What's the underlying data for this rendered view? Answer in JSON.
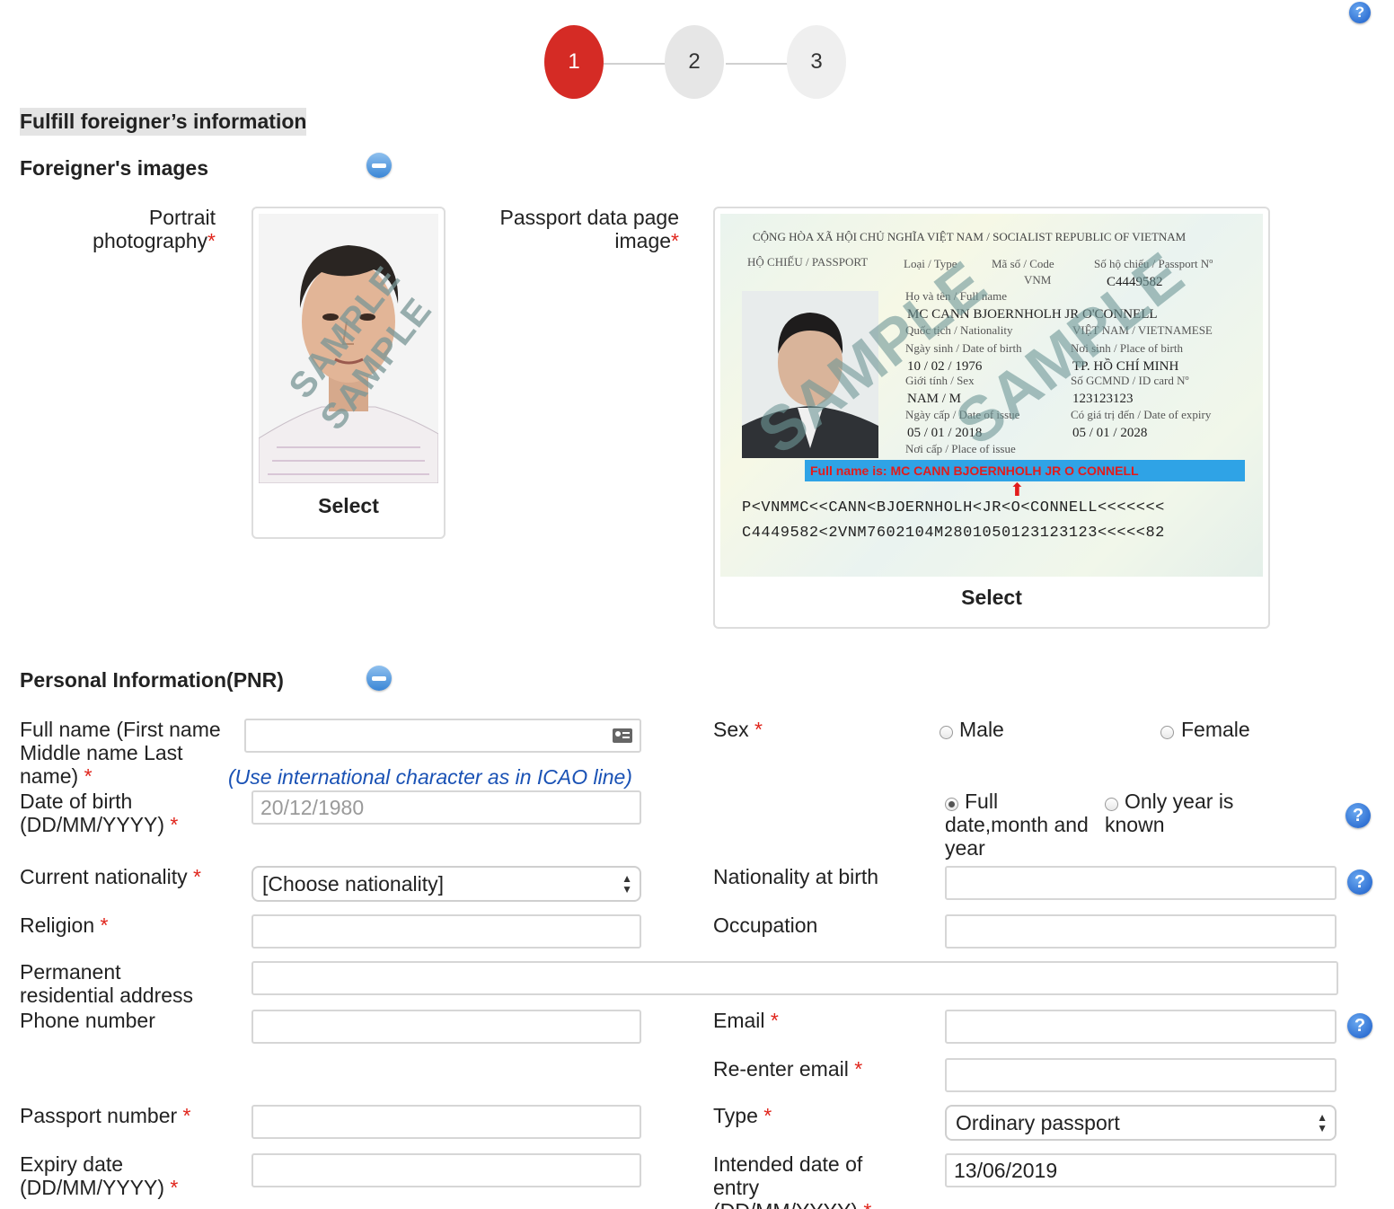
{
  "steps": [
    "1",
    "2",
    "3"
  ],
  "header": {
    "help_icon": "help-icon",
    "title": "Fulfill foreigner’s information"
  },
  "images_section": {
    "title": "Foreigner's images",
    "portrait_label": "Portrait photography",
    "passport_label": "Passport data page image",
    "select_label": "Select",
    "watermark": "SAMPLE"
  },
  "passport_sample": {
    "header": "CỘNG HÒA XÃ HỘI CHỦ NGHĨA VIỆT NAM / SOCIALIST REPUBLIC OF VIETNAM",
    "doc": "HỘ CHIẾU / PASSPORT",
    "type_label": "Loại / Type",
    "code_label": "Mã số / Code",
    "code_value": "VNM",
    "no_label": "Số hộ chiếu / Passport Nº",
    "no_value": "C4449582",
    "name_label": "Họ và tên / Full name",
    "name_value": "MC CANN BJOERNHOLH JR O'CONNELL",
    "nationality_label": "Quốc tịch / Nationality",
    "nationality_value": "VIỆT NAM / VIETNAMESE",
    "dob_label": "Ngày sinh / Date of birth",
    "dob_value": "10 / 02 / 1976",
    "pob_label": "Nơi sinh / Place of birth",
    "pob_value": "TP. HỒ CHÍ MINH",
    "sex_label": "Giới tính / Sex",
    "sex_value": "NAM / M",
    "id_label": "Số GCMND / ID card Nº",
    "id_value": "123123123",
    "issue_label": "Ngày cấp / Date of issue",
    "issue_value": "05 / 01 / 2018",
    "expiry_label": "Có giá trị đến / Date of expiry",
    "expiry_value": "05 / 01 / 2028",
    "poi_label": "Nơi cấp / Place of issue",
    "fullname_banner": "Full name is: MC CANN BJOERNHOLH JR O CONNELL",
    "mrz1": "P<VNMMC<<CANN<BJOERNHOLH<JR<O<CONNELL<<<<<<<",
    "mrz2": "C4449582<2VNM7602104M2801050123123123<<<<<82"
  },
  "personal_section": {
    "title": "Personal Information(PNR)",
    "fullname_label": "Full name (First name Middle name Last name)",
    "fullname_hint": "(Use international character as in ICAO line)",
    "sex_label": "Sex",
    "sex_male": "Male",
    "sex_female": "Female",
    "dob_label": "Date of birth (DD/MM/YYYY)",
    "dob_placeholder": "20/12/1980",
    "dob_full": "Full date,month and year",
    "dob_year": "Only year is known",
    "nationality_label": "Current nationality",
    "nationality_value": "[Choose nationality]",
    "nationality_birth_label": "Nationality at birth",
    "religion_label": "Religion",
    "occupation_label": "Occupation",
    "address_label": "Permanent residential address",
    "phone_label": "Phone number",
    "email_label": "Email",
    "reemail_label": "Re-enter email",
    "passport_no_label": "Passport number",
    "type_label": "Type",
    "type_value": "Ordinary passport",
    "expiry_label": "Expiry date (DD/MM/YYYY)",
    "entry_label": "Intended date of entry (DD/MM/YYYY)",
    "entry_value": "13/06/2019",
    "required_mark": "*"
  },
  "colors": {
    "accent": "#d52b25",
    "required": "#e0241b",
    "hint": "#1a52b5"
  }
}
